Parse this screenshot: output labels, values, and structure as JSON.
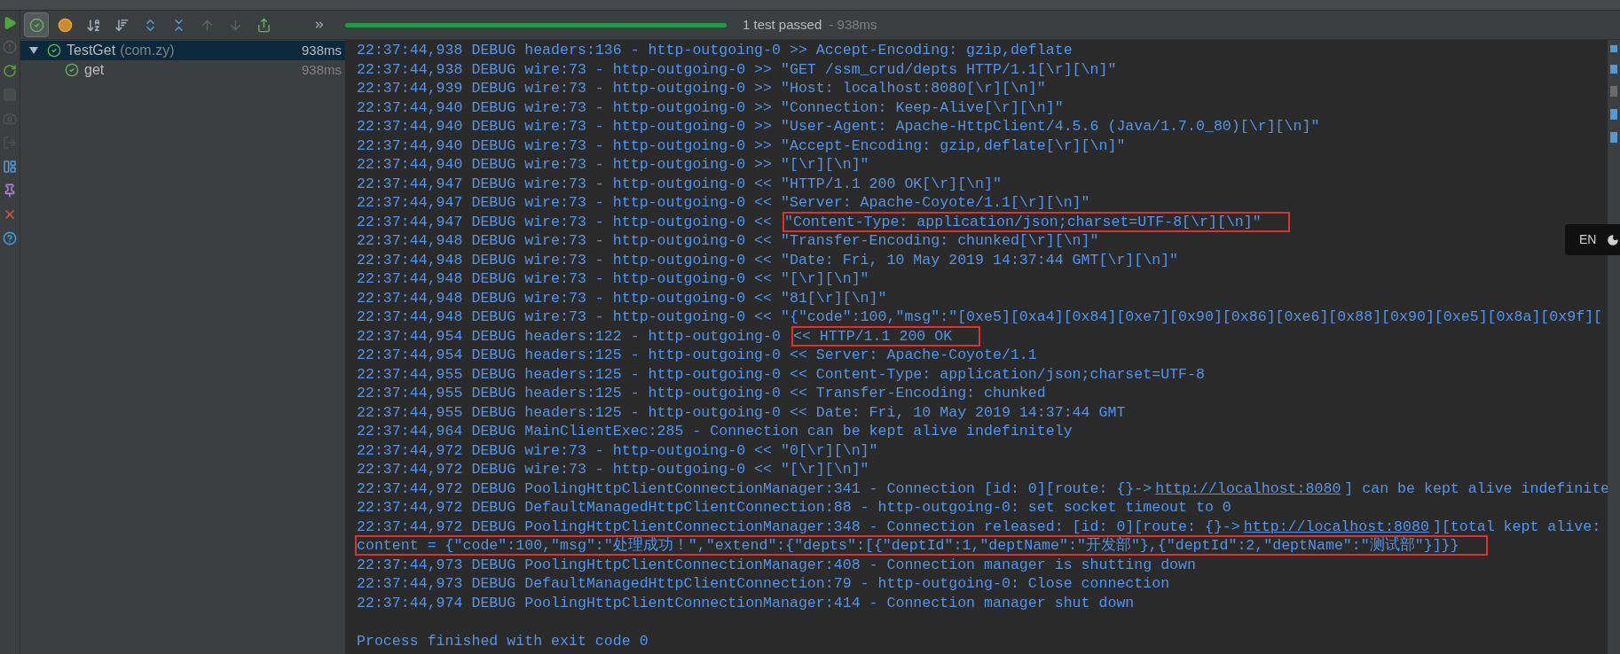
{
  "toolbar": {
    "buttons": [
      {
        "kind": "passed",
        "selected": true,
        "disabled": false
      },
      {
        "kind": "ignored",
        "selected": false,
        "disabled": false
      },
      {
        "kind": "sort-alpha",
        "selected": false,
        "disabled": false
      },
      {
        "kind": "sort-duration",
        "selected": false,
        "disabled": false
      },
      {
        "kind": "expand",
        "selected": false,
        "disabled": false
      },
      {
        "kind": "collapse",
        "selected": false,
        "disabled": false
      },
      {
        "kind": "up",
        "selected": false,
        "disabled": true
      },
      {
        "kind": "down",
        "selected": false,
        "disabled": true
      },
      {
        "kind": "export",
        "selected": false,
        "disabled": false
      }
    ],
    "progress": {
      "level": 1,
      "status": "1 test passed",
      "duration": " - 938ms"
    }
  },
  "side_tools": [
    {
      "kind": "run",
      "disabled": false
    },
    {
      "kind": "warning",
      "disabled": true
    },
    {
      "kind": "rerun",
      "disabled": false
    },
    {
      "kind": "stop",
      "disabled": true
    },
    {
      "kind": "camera",
      "disabled": true
    },
    {
      "kind": "exit",
      "disabled": true
    },
    {
      "kind": "layout",
      "disabled": false
    },
    {
      "kind": "pin",
      "disabled": false
    },
    {
      "kind": "close",
      "disabled": false
    },
    {
      "kind": "help",
      "disabled": false
    }
  ],
  "tree": [
    {
      "name": "TestGet",
      "package": "(com.zy)",
      "time": "938ms",
      "selected": true,
      "expanded": true,
      "passed": true,
      "children": [
        {
          "name": "get",
          "time": "938ms",
          "selected": false,
          "passed": true
        }
      ]
    }
  ],
  "console": {
    "lines": [
      {
        "parts": [
          {
            "text": "22:37:44,938 DEBUG headers:136 - http-outgoing-0 >> Accept-Encoding: gzip,deflate",
            "boxed": false
          }
        ]
      },
      {
        "parts": [
          {
            "text": "22:37:44,938 DEBUG wire:73 - http-outgoing-0 >> \"GET /ssm_crud/depts HTTP/1.1[\\r][\\n]\"",
            "boxed": false
          }
        ]
      },
      {
        "parts": [
          {
            "text": "22:37:44,939 DEBUG wire:73 - http-outgoing-0 >> \"Host: localhost:8080[\\r][\\n]\"",
            "boxed": false
          }
        ]
      },
      {
        "parts": [
          {
            "text": "22:37:44,940 DEBUG wire:73 - http-outgoing-0 >> \"Connection: Keep-Alive[\\r][\\n]\"",
            "boxed": false
          }
        ]
      },
      {
        "parts": [
          {
            "text": "22:37:44,940 DEBUG wire:73 - http-outgoing-0 >> \"User-Agent: Apache-HttpClient/4.5.6 (Java/1.7.0_80)[\\r][\\n]\"",
            "boxed": false
          }
        ]
      },
      {
        "parts": [
          {
            "text": "22:37:44,940 DEBUG wire:73 - http-outgoing-0 >> \"Accept-Encoding: gzip,deflate[\\r][\\n]\"",
            "boxed": false
          }
        ]
      },
      {
        "parts": [
          {
            "text": "22:37:44,940 DEBUG wire:73 - http-outgoing-0 >> \"[\\r][\\n]\"",
            "boxed": false
          }
        ]
      },
      {
        "parts": [
          {
            "text": "22:37:44,947 DEBUG wire:73 - http-outgoing-0 << \"HTTP/1.1 200 OK[\\r][\\n]\"",
            "boxed": false
          }
        ]
      },
      {
        "parts": [
          {
            "text": "22:37:44,947 DEBUG wire:73 - http-outgoing-0 << \"Server: Apache-Coyote/1.1[\\r][\\n]\"",
            "boxed": false
          }
        ]
      },
      {
        "parts": [
          {
            "text": "22:37:44,947 DEBUG wire:73 - http-outgoing-0 << ",
            "boxed": false
          },
          {
            "text": "\"Content-Type: application/json;charset=UTF-8[\\r][\\n]\"",
            "boxed": true
          }
        ]
      },
      {
        "parts": [
          {
            "text": "22:37:44,948 DEBUG wire:73 - http-outgoing-0 << \"Transfer-Encoding: chunked[\\r][\\n]\"",
            "boxed": false
          }
        ]
      },
      {
        "parts": [
          {
            "text": "22:37:44,948 DEBUG wire:73 - http-outgoing-0 << \"Date: Fri, 10 May 2019 14:37:44 GMT[\\r][\\n]\"",
            "boxed": false
          }
        ]
      },
      {
        "parts": [
          {
            "text": "22:37:44,948 DEBUG wire:73 - http-outgoing-0 << \"[\\r][\\n]\"",
            "boxed": false
          }
        ]
      },
      {
        "parts": [
          {
            "text": "22:37:44,948 DEBUG wire:73 - http-outgoing-0 << \"81[\\r][\\n]\"",
            "boxed": false
          }
        ]
      },
      {
        "parts": [
          {
            "text": "22:37:44,948 DEBUG wire:73 - http-outgoing-0 << \"{\"code\":100,\"msg\":\"[0xe5][0xa4][0x84][0xe7][0x90][0x86][0xe6][0x88][0x90][0xe5][0x8a][0x9f][",
            "boxed": false
          }
        ]
      },
      {
        "parts": [
          {
            "text": "22:37:44,954 DEBUG headers:122 - http-outgoing-0 ",
            "boxed": false
          },
          {
            "text": "<< HTTP/1.1 200 OK",
            "boxed": true
          }
        ]
      },
      {
        "parts": [
          {
            "text": "22:37:44,954 DEBUG headers:125 - http-outgoing-0 << Server: Apache-Coyote/1.1",
            "boxed": false
          }
        ]
      },
      {
        "parts": [
          {
            "text": "22:37:44,955 DEBUG headers:125 - http-outgoing-0 << Content-Type: application/json;charset=UTF-8",
            "boxed": false
          }
        ]
      },
      {
        "parts": [
          {
            "text": "22:37:44,955 DEBUG headers:125 - http-outgoing-0 << Transfer-Encoding: chunked",
            "boxed": false
          }
        ]
      },
      {
        "parts": [
          {
            "text": "22:37:44,955 DEBUG headers:125 - http-outgoing-0 << Date: Fri, 10 May 2019 14:37:44 GMT",
            "boxed": false
          }
        ]
      },
      {
        "parts": [
          {
            "text": "22:37:44,964 DEBUG MainClientExec:285 - Connection can be kept alive indefinitely",
            "boxed": false
          }
        ]
      },
      {
        "parts": [
          {
            "text": "22:37:44,972 DEBUG wire:73 - http-outgoing-0 << \"0[\\r][\\n]\"",
            "boxed": false
          }
        ]
      },
      {
        "parts": [
          {
            "text": "22:37:44,972 DEBUG wire:73 - http-outgoing-0 << \"[\\r][\\n]\"",
            "boxed": false
          }
        ]
      },
      {
        "parts": [
          {
            "text": "22:37:44,972 DEBUG PoolingHttpClientConnectionManager:341 - Connection [id: 0][route: {}->",
            "boxed": false
          },
          {
            "text": "http://localhost:8080",
            "kind": "link",
            "boxed": false
          },
          {
            "text": "] can be kept alive indefinite",
            "boxed": false
          }
        ]
      },
      {
        "parts": [
          {
            "text": "22:37:44,972 DEBUG DefaultManagedHttpClientConnection:88 - http-outgoing-0: set socket timeout to 0",
            "boxed": false
          }
        ]
      },
      {
        "parts": [
          {
            "text": "22:37:44,972 DEBUG PoolingHttpClientConnectionManager:348 - Connection released: [id: 0][route: {}->",
            "boxed": false
          },
          {
            "text": "http://localhost:8080",
            "kind": "link",
            "boxed": false
          },
          {
            "text": "][total kept alive:",
            "boxed": false
          }
        ]
      },
      {
        "parts": [
          {
            "text": "content = {\"code\":100,\"msg\":\"处理成功！\",\"extend\":{\"depts\":[{\"deptId\":1,\"deptName\":\"开发部\"},{\"deptId\":2,\"deptName\":\"测试部\"}]}}",
            "boxed": true
          }
        ]
      },
      {
        "parts": [
          {
            "text": "22:37:44,973 DEBUG PoolingHttpClientConnectionManager:408 - Connection manager is shutting down",
            "boxed": false
          }
        ]
      },
      {
        "parts": [
          {
            "text": "22:37:44,973 DEBUG DefaultManagedHttpClientConnection:79 - http-outgoing-0: Close connection",
            "boxed": false
          }
        ]
      },
      {
        "parts": [
          {
            "text": "22:37:44,974 DEBUG PoolingHttpClientConnectionManager:414 - Connection manager shut down",
            "boxed": false
          }
        ]
      },
      {
        "kind": "blank"
      },
      {
        "parts": [
          {
            "text": "Process finished with exit code 0",
            "boxed": false
          }
        ]
      }
    ]
  },
  "ime_indicator": {
    "label": "EN"
  }
}
